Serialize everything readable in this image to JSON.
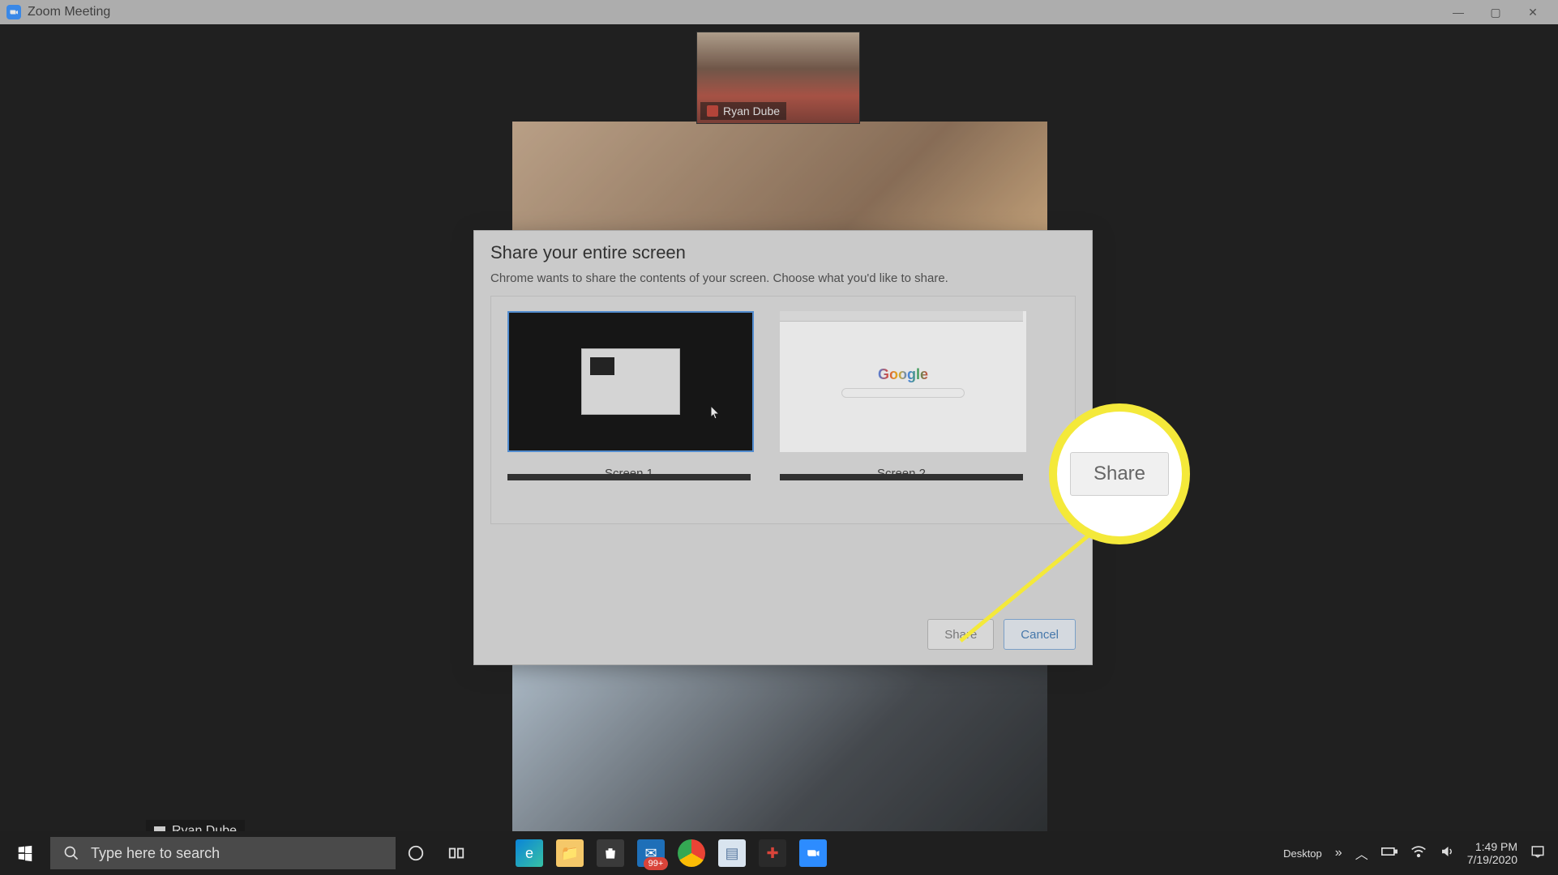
{
  "window": {
    "title": "Zoom Meeting"
  },
  "participant": {
    "self_name": "Ryan Dube",
    "bottom_name": "Ryan Dube"
  },
  "dialog": {
    "title": "Share your entire screen",
    "subtitle": "Chrome wants to share the contents of your screen. Choose what you'd like to share.",
    "screens": [
      {
        "label": "Screen 1"
      },
      {
        "label": "Screen 2"
      }
    ],
    "share_label": "Share",
    "cancel_label": "Cancel"
  },
  "callout": {
    "label": "Share"
  },
  "taskbar": {
    "search_placeholder": "Type here to search",
    "mail_badge": "99+",
    "tray_label": "Desktop",
    "time": "1:49 PM",
    "date": "7/19/2020"
  }
}
